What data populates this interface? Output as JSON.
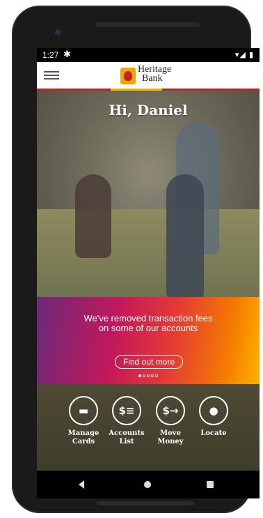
{
  "statusbar": {
    "time": "1:27",
    "settings_icon": "gear-icon",
    "signal_glyph": "▾◢ ▮"
  },
  "header": {
    "logo_line1": "Heritage",
    "logo_line2": "Bank",
    "brand_color": "#c5221f",
    "accent_color": "#f5b700"
  },
  "hero": {
    "greeting": "Hi, Daniel"
  },
  "promo": {
    "message": "We've removed transaction fees on some of our accounts",
    "button_label": "Find out more",
    "carousel_active_index": 1,
    "carousel_total": 5
  },
  "actions": [
    {
      "label_line1": "Manage",
      "label_line2": "Cards",
      "icon": "card-icon",
      "glyph": "▬"
    },
    {
      "label_line1": "Accounts",
      "label_line2": "List",
      "icon": "dollar-list-icon",
      "glyph": "$≡"
    },
    {
      "label_line1": "Move",
      "label_line2": "Money",
      "icon": "dollar-arrow-icon",
      "glyph": "$→"
    },
    {
      "label_line1": "Locate",
      "label_line2": "",
      "icon": "location-pin-icon",
      "glyph": "●"
    }
  ]
}
